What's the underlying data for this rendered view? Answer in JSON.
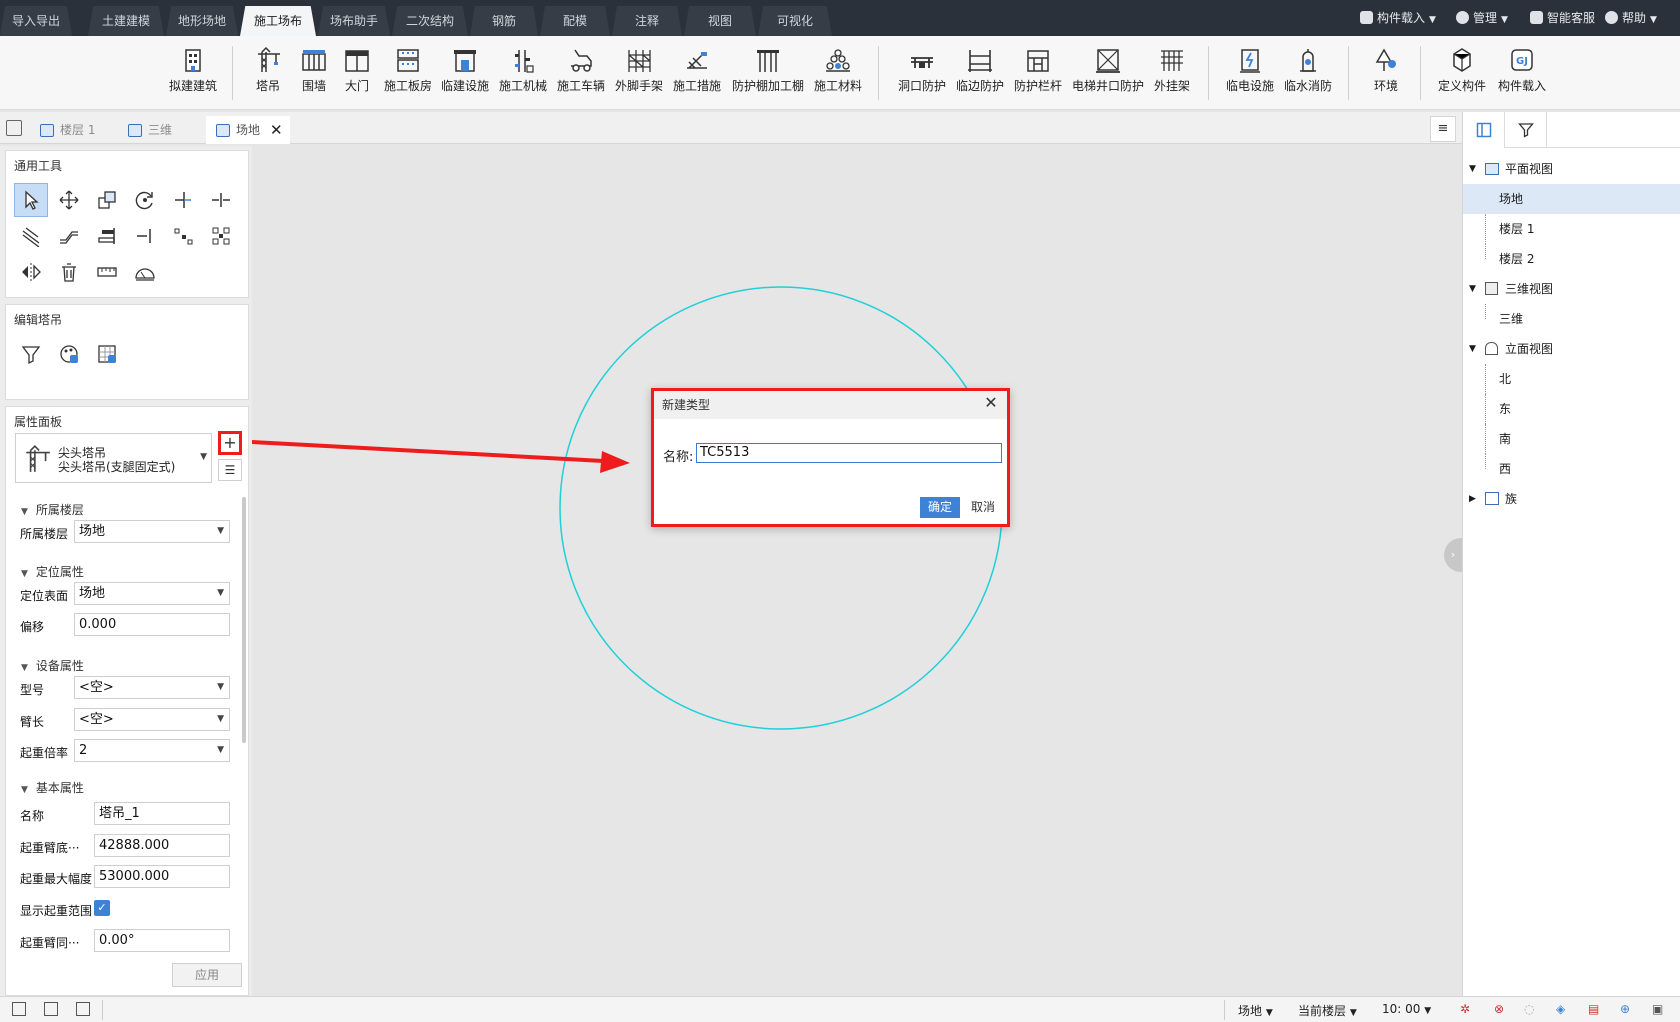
{
  "topbar": {
    "tabs": [
      "导入导出",
      "土建建模",
      "地形场地",
      "施工场布",
      "场布助手",
      "二次结构",
      "钢筋",
      "配模",
      "注释",
      "视图",
      "可视化"
    ],
    "active_tab": "施工场布",
    "right": {
      "load_label": "构件载入",
      "manage_label": "管理",
      "service_label": "智能客服",
      "help_label": "帮助"
    }
  },
  "ribbon": {
    "buttons": [
      {
        "label": "拟建建筑",
        "icon": "building-icon"
      },
      {
        "label": "塔吊",
        "icon": "tower-crane-icon"
      },
      {
        "label": "围墙",
        "icon": "fence-icon"
      },
      {
        "label": "大门",
        "icon": "gate-icon"
      },
      {
        "label": "施工板房",
        "icon": "site-house-icon"
      },
      {
        "label": "临建设施",
        "icon": "temp-facility-icon"
      },
      {
        "label": "施工机械",
        "icon": "machinery-icon"
      },
      {
        "label": "施工车辆",
        "icon": "vehicle-icon"
      },
      {
        "label": "外脚手架",
        "icon": "scaffold-icon"
      },
      {
        "label": "施工措施",
        "icon": "measure-icon"
      },
      {
        "label": "防护棚加工棚",
        "icon": "shed-icon"
      },
      {
        "label": "施工材料",
        "icon": "material-icon"
      },
      {
        "label": "洞口防护",
        "icon": "opening-protect-icon"
      },
      {
        "label": "临边防护",
        "icon": "edge-protect-icon"
      },
      {
        "label": "防护栏杆",
        "icon": "railing-icon"
      },
      {
        "label": "电梯井口防护",
        "icon": "elevator-protect-icon"
      },
      {
        "label": "外挂架",
        "icon": "hanging-frame-icon"
      },
      {
        "label": "临电设施",
        "icon": "temp-power-icon"
      },
      {
        "label": "临水消防",
        "icon": "fire-hydrant-icon"
      },
      {
        "label": "环境",
        "icon": "environment-icon"
      },
      {
        "label": "定义构件",
        "icon": "define-component-icon"
      },
      {
        "label": "构件载入",
        "icon": "component-load-icon"
      }
    ]
  },
  "doc_tabs": {
    "tabs": [
      {
        "label": "楼层 1"
      },
      {
        "label": "三维"
      },
      {
        "label": "场地"
      }
    ],
    "active": "场地"
  },
  "left": {
    "general_tools_title": "通用工具",
    "edit_title": "编辑塔吊",
    "props_title": "属性面板",
    "component": {
      "line1": "尖头塔吊",
      "line2": "尖头塔吊(支腿固定式)"
    },
    "add_button": "+",
    "sections": {
      "floor": "所属楼层",
      "position": "定位属性",
      "equipment": "设备属性",
      "basic": "基本属性"
    },
    "props": {
      "floor_label": "所属楼层",
      "floor_value": "场地",
      "surface_label": "定位表面",
      "surface_value": "场地",
      "offset_label": "偏移",
      "offset_value": "0.000",
      "model_label": "型号",
      "model_value": "<空>",
      "arm_label": "臂长",
      "arm_value": "<空>",
      "rate_label": "起重倍率",
      "rate_value": "2",
      "name_label": "名称",
      "name_value": "塔吊_1",
      "base_label": "起重臂底···",
      "base_value": "42888.000",
      "max_label": "起重最大幅度",
      "max_value": "53000.000",
      "show_label": "显示起重范围",
      "dir_label": "起重臂同···",
      "dir_value": "0.00°"
    },
    "apply_label": "应用"
  },
  "dialog": {
    "title": "新建类型",
    "name_label": "名称:",
    "name_value": "TC5513",
    "ok": "确定",
    "cancel": "取消"
  },
  "tree": {
    "plan": "平面视图",
    "site": "场地",
    "floor1": "楼层 1",
    "floor2": "楼层 2",
    "three_d": "三维视图",
    "three_d_item": "三维",
    "elevation": "立面视图",
    "north": "北",
    "east": "东",
    "south": "南",
    "west": "西",
    "family": "族"
  },
  "status": {
    "site": "场地",
    "current_floor": "当前楼层",
    "time": "10: 00"
  },
  "colors": {
    "accent": "#3e82d6",
    "crane_circle": "#1fd0d8",
    "highlight": "#ee1c1c",
    "topbar": "#2b313a"
  }
}
